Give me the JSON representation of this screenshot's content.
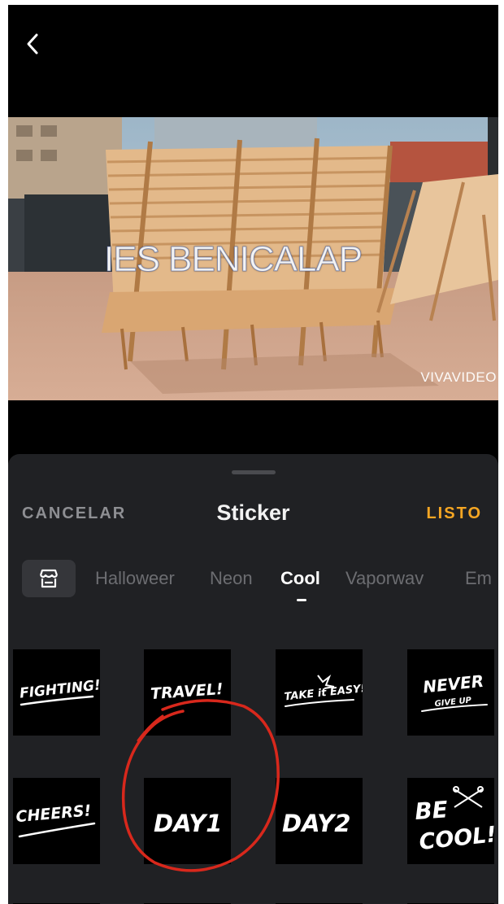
{
  "preview": {
    "overlay_text": "IES BENICALAP",
    "watermark": "VIVAVIDEO"
  },
  "sheet": {
    "cancel_label": "CANCELAR",
    "title": "Sticker",
    "done_label": "LISTO"
  },
  "tabs": [
    {
      "label": "Halloweer",
      "active": false
    },
    {
      "label": "Neon",
      "active": false
    },
    {
      "label": "Cool",
      "active": true
    },
    {
      "label": "Vaporwav",
      "active": false
    },
    {
      "label": "Em",
      "active": false
    }
  ],
  "stickers": [
    {
      "text": "FIGHTING!"
    },
    {
      "text": "TRAVEL!"
    },
    {
      "text": "TAKE it EASY!"
    },
    {
      "text": "NEVER",
      "sub": "GIVE UP"
    },
    {
      "text": "CHEERS!"
    },
    {
      "text": "DAY1"
    },
    {
      "text": "DAY2"
    },
    {
      "text": "BE",
      "sub": "COOL!"
    }
  ],
  "colors": {
    "accent": "#f5a623",
    "sheet_bg": "#202124",
    "annotation": "#d8281c"
  }
}
